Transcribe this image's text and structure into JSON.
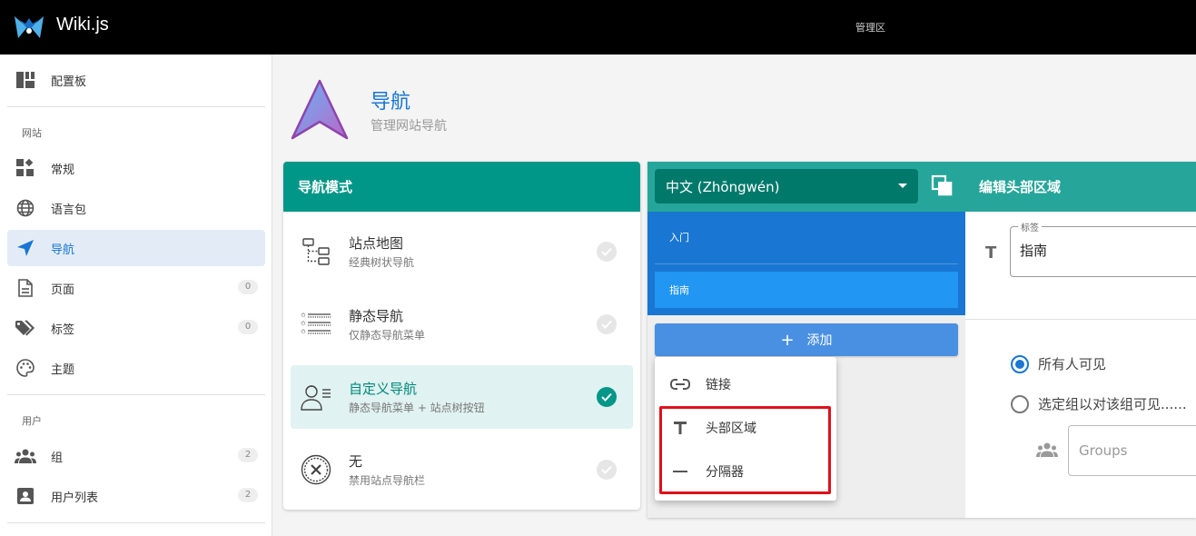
{
  "app": {
    "title": "Wiki.js",
    "admin_label": "管理区"
  },
  "sidebar": {
    "dashboard": "配置板",
    "section_site": "网站",
    "general": "常规",
    "locale": "语言包",
    "navigation": "导航",
    "pages": {
      "label": "页面",
      "count": "0"
    },
    "tags": {
      "label": "标签",
      "count": "0"
    },
    "theme": "主题",
    "section_users": "用户",
    "groups": {
      "label": "组",
      "count": "2"
    },
    "users": {
      "label": "用户列表",
      "count": "2"
    }
  },
  "page": {
    "title": "导航",
    "subtitle": "管理网站导航"
  },
  "mode_card": {
    "title": "导航模式",
    "items": [
      {
        "title": "站点地图",
        "desc": "经典树状导航"
      },
      {
        "title": "静态导航",
        "desc": "仅静态导航菜单"
      },
      {
        "title": "自定义导航",
        "desc": "静态导航菜单 + 站点树按钮"
      },
      {
        "title": "无",
        "desc": "禁用站点导航栏"
      }
    ],
    "selected_index": 2
  },
  "editor": {
    "locale_value": "中文 (Zhōngwén)",
    "edit_title": "编辑头部区域",
    "items": [
      "入门",
      "指南"
    ],
    "selected_item": 1,
    "add_label": "添加",
    "menu": [
      {
        "label": "链接",
        "icon": "link-icon"
      },
      {
        "label": "头部区域",
        "icon": "text-header-icon"
      },
      {
        "label": "分隔器",
        "icon": "divider-icon"
      }
    ],
    "label_legend": "标签",
    "label_value": "指南",
    "visibility": {
      "all": "所有人可见",
      "groups": "选定组以对该组可见......"
    },
    "groups_placeholder": "Groups"
  },
  "colors": {
    "primary": "#1976d2",
    "teal": "#009688",
    "highlight": "#e0101a"
  }
}
